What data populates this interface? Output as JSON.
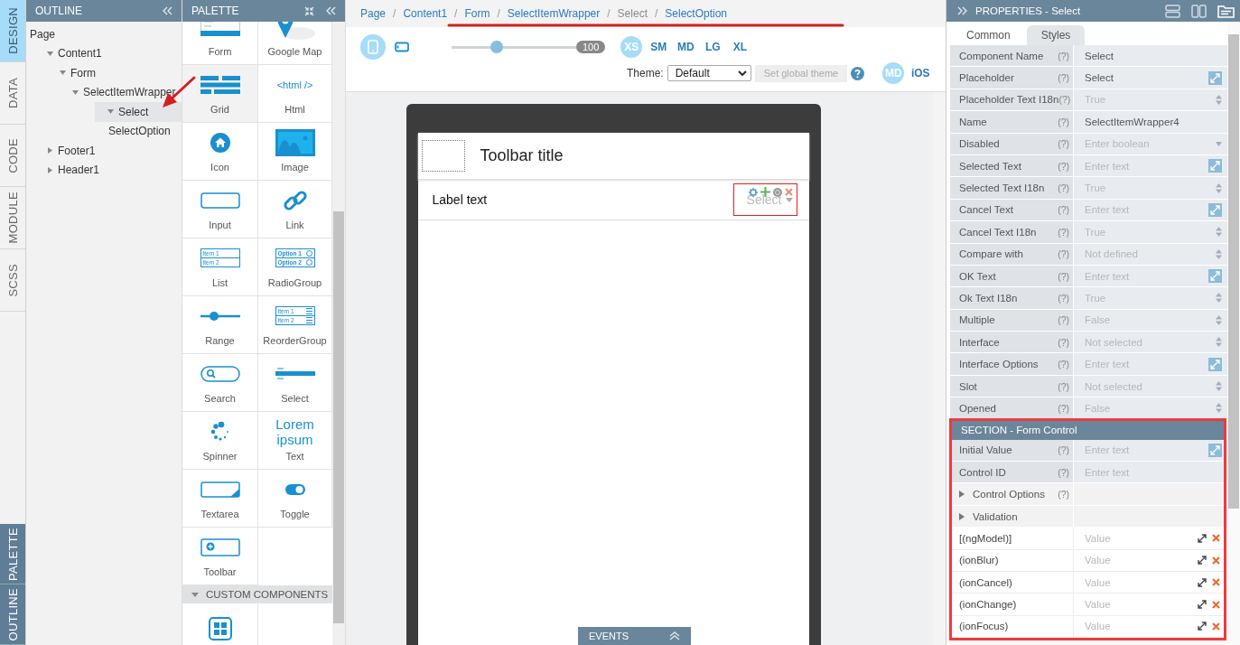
{
  "side_tabs": {
    "top": [
      {
        "label": "DESIGN",
        "selected": true
      },
      {
        "label": "DATA",
        "selected": false
      },
      {
        "label": "CODE",
        "selected": false
      },
      {
        "label": "MODULE",
        "selected": false
      },
      {
        "label": "SCSS",
        "selected": false
      }
    ],
    "bottom": [
      {
        "label": "PALETTE",
        "selected": false
      },
      {
        "label": "OUTLINE",
        "selected": false
      }
    ]
  },
  "outline": {
    "title": "OUTLINE",
    "tree": [
      {
        "label": "Page",
        "selected": false,
        "children": [
          {
            "label": "Content1",
            "expanded": true,
            "selected": false,
            "children": [
              {
                "label": "Form",
                "expanded": true,
                "selected": false,
                "children": [
                  {
                    "label": "SelectItemWrapper",
                    "expanded": true,
                    "selected": false,
                    "children": [
                      {
                        "label": "Select",
                        "expanded": true,
                        "selected": true,
                        "children": [
                          {
                            "label": "SelectOption",
                            "selected": false
                          }
                        ]
                      }
                    ]
                  }
                ]
              }
            ]
          },
          {
            "label": "Footer1",
            "expanded": false,
            "selected": false
          },
          {
            "label": "Header1",
            "expanded": false,
            "selected": false
          }
        ]
      }
    ]
  },
  "palette": {
    "title": "PALETTE",
    "items": [
      {
        "label": "Form",
        "kind": "form",
        "highlighted": false
      },
      {
        "label": "Google Map",
        "kind": "map",
        "highlighted": false
      },
      {
        "label": "Grid",
        "kind": "grid",
        "highlighted": true
      },
      {
        "label": "Html",
        "kind": "html",
        "icon_text": "<html />",
        "highlighted": false
      },
      {
        "label": "Icon",
        "kind": "icon",
        "highlighted": false
      },
      {
        "label": "Image",
        "kind": "image",
        "highlighted": false
      },
      {
        "label": "Input",
        "kind": "input",
        "highlighted": false
      },
      {
        "label": "Link",
        "kind": "link",
        "highlighted": false
      },
      {
        "label": "List",
        "kind": "list",
        "icon_texts": [
          "Item 1",
          "Item 2"
        ],
        "highlighted": false
      },
      {
        "label": "RadioGroup",
        "kind": "radio",
        "icon_texts": [
          "Option 1",
          "Option 2"
        ],
        "highlighted": false
      },
      {
        "label": "Range",
        "kind": "range",
        "highlighted": false
      },
      {
        "label": "ReorderGroup",
        "kind": "reorder",
        "icon_texts": [
          "Item 1",
          "Item 2"
        ],
        "highlighted": false
      },
      {
        "label": "Search",
        "kind": "search",
        "highlighted": false
      },
      {
        "label": "Select",
        "kind": "select",
        "highlighted": false
      },
      {
        "label": "Spinner",
        "kind": "spinner",
        "highlighted": false
      },
      {
        "label": "Text",
        "kind": "text",
        "icon_text": "Lorem ipsum",
        "highlighted": false
      },
      {
        "label": "Textarea",
        "kind": "textarea",
        "highlighted": false
      },
      {
        "label": "Toggle",
        "kind": "toggle",
        "highlighted": false
      },
      {
        "label": "Toolbar",
        "kind": "toolbar",
        "highlighted": false
      }
    ],
    "custom_section": {
      "title": "CUSTOM COMPONENTS",
      "expanded": true,
      "items": [
        {
          "kind": "tiles"
        }
      ]
    }
  },
  "breadcrumb": {
    "separator": "/",
    "items": [
      {
        "label": "Page",
        "link": true
      },
      {
        "label": "Content1",
        "link": true
      },
      {
        "label": "Form",
        "link": true
      },
      {
        "label": "SelectItemWrapper",
        "link": true
      },
      {
        "label": "Select",
        "link": false
      },
      {
        "label": "SelectOption",
        "link": true
      }
    ]
  },
  "toolbar": {
    "devices": [
      {
        "kind": "phone",
        "selected": true
      },
      {
        "kind": "tablet",
        "selected": false
      }
    ],
    "zoom": {
      "level": 0.36,
      "reading": "100"
    },
    "breakpoints": [
      {
        "label": "XS",
        "selected": true
      },
      {
        "label": "SM",
        "selected": false
      },
      {
        "label": "MD",
        "selected": false
      },
      {
        "label": "LG",
        "selected": false
      },
      {
        "label": "XL",
        "selected": false
      }
    ],
    "theme": {
      "label": "Theme:",
      "value": "Default"
    },
    "set_theme_button": {
      "label": "Set global theme",
      "disabled": true
    },
    "modes": [
      {
        "label": "MD",
        "selected": true
      },
      {
        "label": "iOS",
        "selected": false
      }
    ]
  },
  "canvas": {
    "toolbar_title": "Toolbar title",
    "item_label": "Label text",
    "select_placeholder": "Select",
    "events_tab": "EVENTS"
  },
  "properties": {
    "title": "PROPERTIES - Select",
    "tabs": [
      {
        "label": "Common",
        "selected": true
      },
      {
        "label": "Styles",
        "selected": false
      }
    ],
    "rows": [
      {
        "label": "Component Name",
        "help": "(?)",
        "value": "Select",
        "kind": "text"
      },
      {
        "label": "Placeholder",
        "help": "(?)",
        "value": "Select",
        "kind": "expand"
      },
      {
        "label": "Placeholder Text I18n",
        "help": "(?)",
        "placeholder": "True",
        "kind": "spinner"
      },
      {
        "label": "Name",
        "help": "(?)",
        "value": "SelectItemWrapper4",
        "kind": "text"
      },
      {
        "label": "Disabled",
        "help": "(?)",
        "placeholder": "Enter boolean",
        "kind": "dropdown"
      },
      {
        "label": "Selected Text",
        "help": "(?)",
        "placeholder": "Enter text",
        "kind": "expand"
      },
      {
        "label": "Selected Text I18n",
        "help": "(?)",
        "placeholder": "True",
        "kind": "spinner"
      },
      {
        "label": "Cancel Text",
        "help": "(?)",
        "placeholder": "Enter text",
        "kind": "expand"
      },
      {
        "label": "Cancel Text I18n",
        "help": "(?)",
        "placeholder": "True",
        "kind": "spinner"
      },
      {
        "label": "Compare with",
        "help": "(?)",
        "placeholder": "Not defined",
        "kind": "spinner"
      },
      {
        "label": "OK Text",
        "help": "(?)",
        "placeholder": "Enter text",
        "kind": "expand"
      },
      {
        "label": "Ok Text I18n",
        "help": "(?)",
        "placeholder": "True",
        "kind": "spinner"
      },
      {
        "label": "Multiple",
        "help": "(?)",
        "placeholder": "False",
        "kind": "spinner"
      },
      {
        "label": "Interface",
        "help": "(?)",
        "placeholder": "Not selected",
        "kind": "spinner"
      },
      {
        "label": "Interface Options",
        "help": "(?)",
        "placeholder": "Enter text",
        "kind": "expand"
      },
      {
        "label": "Slot",
        "help": "(?)",
        "placeholder": "Not selected",
        "kind": "spinner"
      },
      {
        "label": "Opened",
        "help": "(?)",
        "placeholder": "False",
        "kind": "spinner"
      }
    ],
    "section": {
      "title": "SECTION - Form Control",
      "rows": [
        {
          "label": "Initial Value",
          "help": "(?)",
          "placeholder": "Enter text",
          "kind": "expand"
        },
        {
          "label": "Control ID",
          "help": "(?)",
          "placeholder": "Enter text",
          "kind": "text"
        }
      ],
      "groups": [
        {
          "label": "Control Options",
          "help": "(?)",
          "expanded": false
        },
        {
          "label": "Validation",
          "expanded": false
        }
      ],
      "events": [
        {
          "label": "[(ngModel)]",
          "placeholder": "Value"
        },
        {
          "label": "(ionBlur)",
          "placeholder": "Value"
        },
        {
          "label": "(ionCancel)",
          "placeholder": "Value"
        },
        {
          "label": "(ionChange)",
          "placeholder": "Value"
        },
        {
          "label": "(ionFocus)",
          "placeholder": "Value"
        }
      ]
    }
  }
}
